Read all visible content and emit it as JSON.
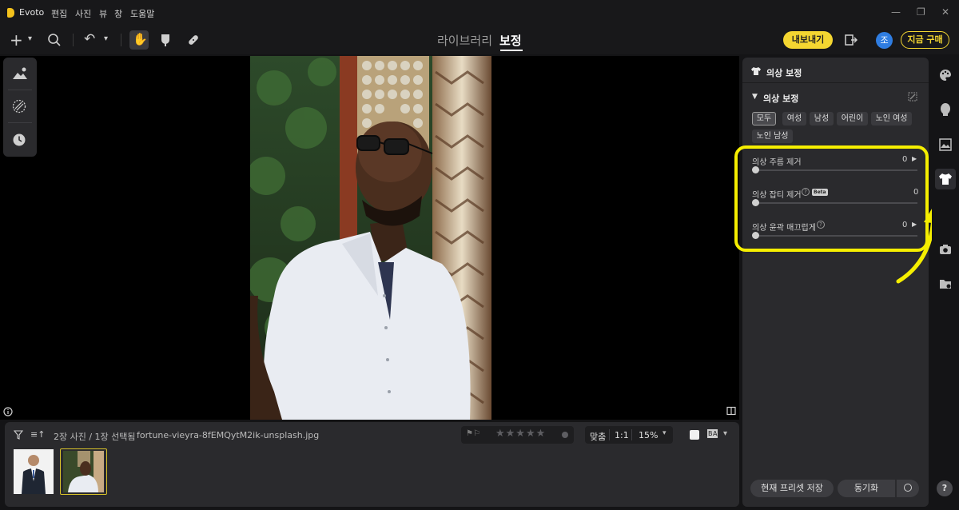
{
  "app": {
    "name": "Evoto"
  },
  "menu": [
    "편집",
    "사진",
    "뷰",
    "창",
    "도움말"
  ],
  "modes": {
    "library": "라이브러리",
    "edit": "보정"
  },
  "header_actions": {
    "export": "내보내기",
    "avatar": "조",
    "buy": "지금 구매"
  },
  "panel": {
    "title": "의상 보정",
    "section_title": "의상 보정",
    "chips": [
      "모두",
      "여성",
      "남성",
      "어린이",
      "노인 여성",
      "노인 남성"
    ],
    "active_chip_index": 0,
    "sliders": [
      {
        "label": "의상 주름 제거",
        "value": "0",
        "level": 0,
        "expandable": true,
        "help": false,
        "beta": false
      },
      {
        "label": "의상 잡티 제거",
        "value": "0",
        "level": 0,
        "expandable": false,
        "help": true,
        "beta": true
      },
      {
        "label": "의상 윤곽 매끄럽게",
        "value": "0",
        "level": 0,
        "expandable": true,
        "help": true,
        "beta": false
      }
    ],
    "beta_label": "Beta",
    "buttons": {
      "save_preset": "현재 프리셋 저장",
      "sync": "동기화"
    }
  },
  "filmstrip": {
    "count_text": "2장 사진 / 1장 선택됨",
    "filename": "fortune-vieyra-8fEMQytM2ik-unsplash.jpg",
    "zoom_fit": "맞춤",
    "zoom_1to1": "1:1",
    "zoom_level": "15%",
    "rating": 0,
    "compare_label": "B A"
  },
  "colors": {
    "accent_yellow": "#f4d631",
    "highlight_yellow": "#f5ee00",
    "avatar_blue": "#2f7de1"
  }
}
